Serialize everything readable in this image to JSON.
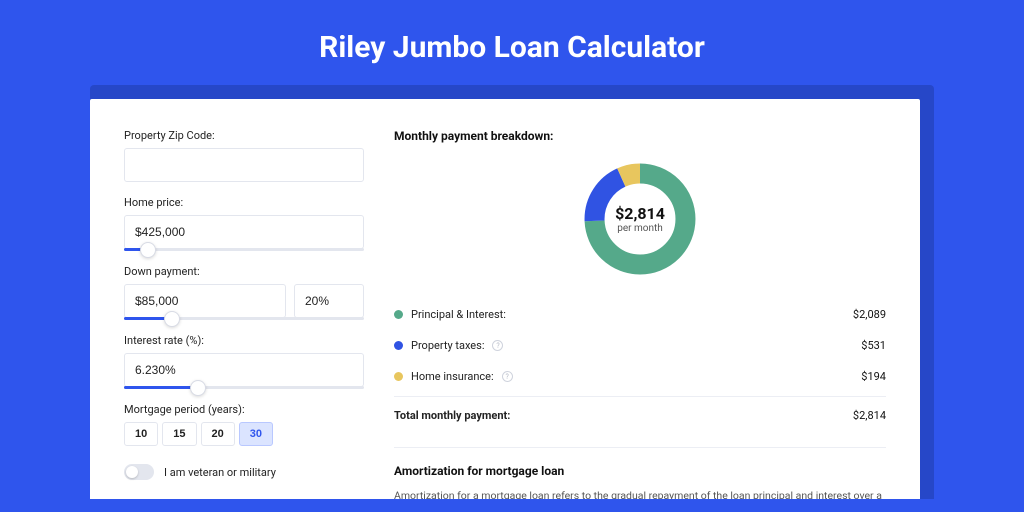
{
  "title": "Riley Jumbo Loan Calculator",
  "form": {
    "zip_label": "Property Zip Code:",
    "zip_value": "",
    "home_price_label": "Home price:",
    "home_price_value": "$425,000",
    "down_payment_label": "Down payment:",
    "down_payment_amount": "$85,000",
    "down_payment_percent": "20%",
    "interest_label": "Interest rate (%):",
    "interest_value": "6.230%",
    "period_label": "Mortgage period (years):",
    "period_options": [
      "10",
      "15",
      "20",
      "30"
    ],
    "period_selected": "30",
    "veteran_label": "I am veteran or military"
  },
  "breakdown": {
    "heading": "Monthly payment breakdown:",
    "donut_amount": "$2,814",
    "donut_sub": "per month",
    "items": [
      {
        "label": "Principal & Interest:",
        "value": "$2,089"
      },
      {
        "label": "Property taxes:",
        "value": "$531"
      },
      {
        "label": "Home insurance:",
        "value": "$194"
      }
    ],
    "total_label": "Total monthly payment:",
    "total_value": "$2,814"
  },
  "amortization": {
    "heading": "Amortization for mortgage loan",
    "text": "Amortization for a mortgage loan refers to the gradual repayment of the loan principal and interest over a specified"
  },
  "chart_data": {
    "type": "pie",
    "title": "Monthly payment breakdown",
    "series": [
      {
        "name": "Principal & Interest",
        "value": 2089,
        "color": "#55a98a"
      },
      {
        "name": "Property taxes",
        "value": 531,
        "color": "#3053e3"
      },
      {
        "name": "Home insurance",
        "value": 194,
        "color": "#e8c65e"
      }
    ],
    "total": 2814,
    "center_label": "$2,814 per month"
  }
}
